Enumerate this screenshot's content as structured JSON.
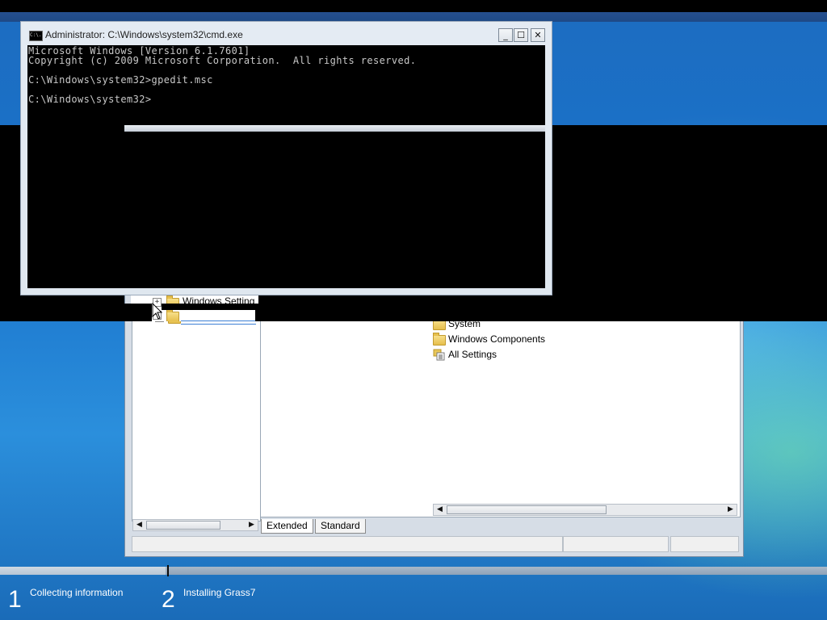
{
  "cmd": {
    "title": "Administrator: C:\\Windows\\system32\\cmd.exe",
    "icon_label": "C:\\.",
    "lines": [
      "Microsoft Windows [Version 6.1.7601]",
      "Copyright (c) 2009 Microsoft Corporation.  All rights reserved.",
      "",
      "C:\\Windows\\system32>gpedit.msc",
      "",
      "C:\\Windows\\system32>"
    ],
    "minimize_glyph": "_",
    "maximize_glyph": "☐",
    "close_glyph": "✕"
  },
  "gpedit": {
    "tree": {
      "items": [
        {
          "label": "Windows Setting",
          "expander": "+"
        }
      ]
    },
    "list": {
      "items": [
        {
          "label": "System",
          "icon": "folder-icon"
        },
        {
          "label": "Windows Components",
          "icon": "folder-icon"
        },
        {
          "label": "All Settings",
          "icon": "settings-list-icon"
        }
      ]
    },
    "tabs": [
      "Extended",
      "Standard"
    ],
    "scroll": {
      "left_arrow": "◀",
      "right_arrow": "▶"
    }
  },
  "setup": {
    "steps": [
      {
        "number": "1",
        "label": "Collecting information"
      },
      {
        "number": "2",
        "label": "Installing Grass7"
      }
    ],
    "progress": 0.2
  },
  "colors": {
    "console_bg": "#000000",
    "console_text": "#c8c8c8",
    "desktop_blue": "#1a74cc"
  }
}
